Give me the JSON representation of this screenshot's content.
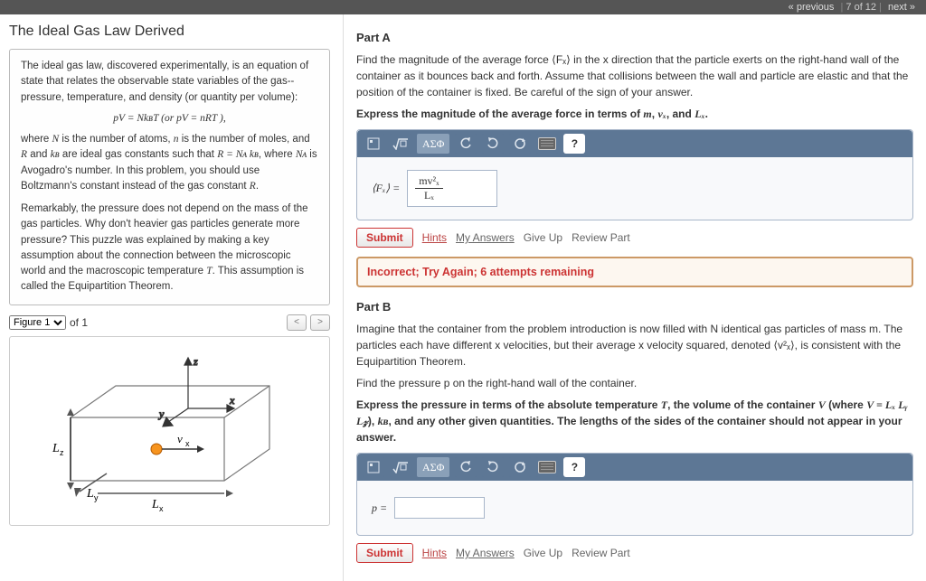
{
  "nav": {
    "prev": "« previous",
    "counter": "7 of 12",
    "next": "next »"
  },
  "left": {
    "title": "The Ideal Gas Law Derived",
    "intro": "The ideal gas law, discovered experimentally, is an equation of state that relates the observable state variables of the gas--pressure, temperature, and density (or quantity per volume):",
    "equation": "pV = NkʙT (or pV = nRT ),",
    "para2a": "where ",
    "para2b": " is the number of atoms, ",
    "para2c": " is the number of moles, and ",
    "para2d": " and ",
    "para2e": " are ideal gas constants such that ",
    "para2f": ", where ",
    "para2g": " is Avogadro's number. In this problem, you should use Boltzmann's constant instead of the gas constant ",
    "para3": "Remarkably, the pressure does not depend on the mass of the gas particles. Why don't heavier gas particles generate more pressure? This puzzle was explained by making a key assumption about the connection between the microscopic world and the macroscopic temperature ",
    "para3b": ". This assumption is called the Equipartition Theorem.",
    "fig_label": "Figure 1",
    "fig_of": "of 1",
    "N": "N",
    "n_": "n",
    "R": "R",
    "kB": "kʙ",
    "NA": "Nᴀ",
    "T": "T",
    "eq2": "R = Nᴀ kʙ"
  },
  "partA": {
    "title": "Part A",
    "p1": "Find the magnitude of the average force ⟨Fₓ⟩ in the x direction that the particle exerts on the right-hand wall of the container as it bounces back and forth. Assume that collisions between the wall and particle are elastic and that the position of the container is fixed. Be careful of the sign of your answer.",
    "p2a": "Express the magnitude of the average force in terms of ",
    "p2b": ", and ",
    "m": "m",
    "vx": "vₓ",
    "Lx": "Lₓ",
    "lhs": "⟨Fₓ⟩ =",
    "answer_num": "mv²ₓ",
    "answer_den": "Lₓ",
    "submit": "Submit",
    "hints": "Hints",
    "my_answers": "My Answers",
    "give_up": "Give Up",
    "review": "Review Part",
    "feedback": "Incorrect; Try Again; 6 attempts remaining"
  },
  "partB": {
    "title": "Part B",
    "p1": "Imagine that the container from the problem introduction is now filled with N identical gas particles of mass m. The particles each have different x velocities, but their average x velocity squared, denoted ⟨v²ₓ⟩, is consistent with the Equipartition Theorem.",
    "p2": "Find the pressure p on the right-hand wall of the container.",
    "p3a": "Express the pressure in terms of the absolute temperature ",
    "p3b": ", the volume of the container ",
    "p3c": " (where ",
    "p3d": "), ",
    "p3e": ", and any other given quantities. The lengths of the sides of the container should not appear in your answer.",
    "T": "T",
    "V": "V",
    "eqV": "V = Lₓ Lᵧ L𝓏",
    "kB": "kʙ",
    "lhs": "p =",
    "submit": "Submit",
    "hints": "Hints",
    "my_answers": "My Answers",
    "give_up": "Give Up",
    "review": "Review Part"
  },
  "toolbar": {
    "greek": "ΑΣΦ",
    "help": "?"
  }
}
